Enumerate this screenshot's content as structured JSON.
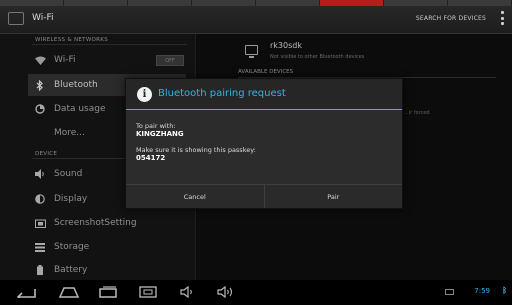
{
  "window": {
    "title": "Wi-Fi",
    "action": "SEARCH FOR DEVICES"
  },
  "sidebar": {
    "header_wireless": "WIRELESS & NETWORKS",
    "header_device": "DEVICE",
    "wifi_toggle": "OFF",
    "items": [
      {
        "label": "Wi-Fi",
        "icon": "wifi-icon"
      },
      {
        "label": "Bluetooth",
        "icon": "bluetooth-icon"
      },
      {
        "label": "Data usage",
        "icon": "data-usage-icon"
      },
      {
        "label": "More..."
      },
      {
        "label": "Sound",
        "icon": "sound-icon"
      },
      {
        "label": "Display",
        "icon": "display-icon"
      },
      {
        "label": "ScreenshotSetting",
        "icon": "screenshot-icon"
      },
      {
        "label": "Storage",
        "icon": "storage-icon"
      },
      {
        "label": "Battery",
        "icon": "battery-icon"
      }
    ]
  },
  "device": {
    "name": "rk30sdk",
    "subtitle": "Not visible to other Bluetooth devices",
    "available_header": "AVAILABLE DEVICES",
    "paired_hint": "...ir forced"
  },
  "dialog": {
    "title": "Bluetooth pairing request",
    "pair_with_label": "To pair with:",
    "device_name": "KINGZHANG",
    "passkey_label": "Make sure it is showing this passkey:",
    "passkey": "054172",
    "cancel": "Cancel",
    "pair": "Pair"
  },
  "statusbar": {
    "time": "7:59"
  },
  "colors": {
    "accent": "#33b5e5",
    "recording": "#b91b1b"
  }
}
